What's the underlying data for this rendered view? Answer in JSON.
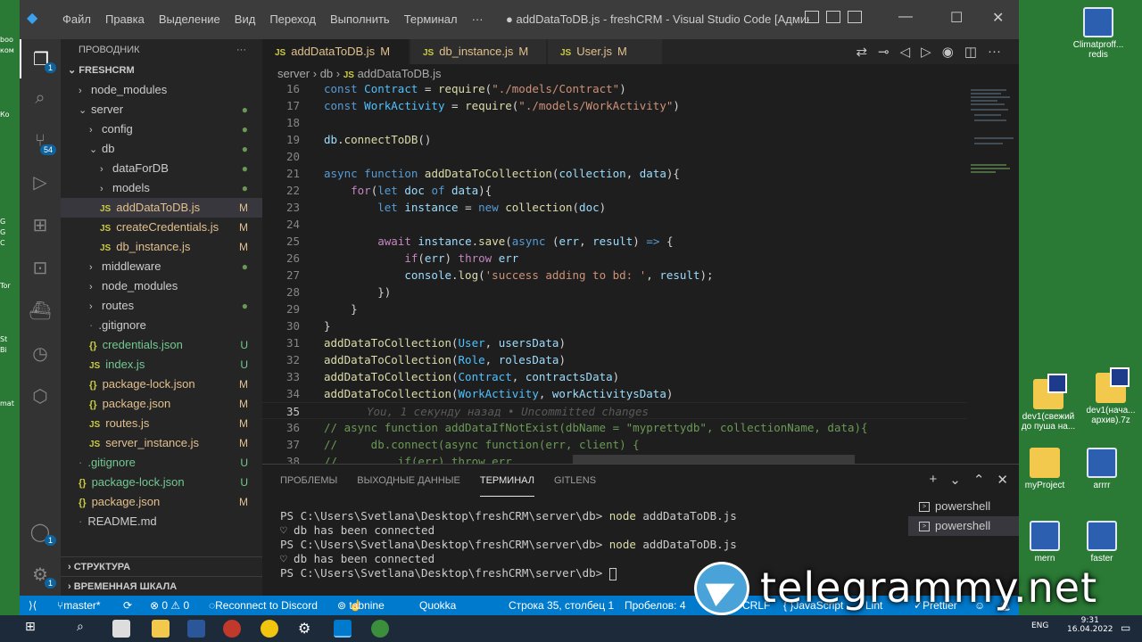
{
  "desktop": {
    "left_labels": [
      "boo",
      "ком",
      "",
      "",
      "",
      "",
      "",
      "Ко",
      "",
      "",
      "",
      "",
      "",
      "",
      "",
      "",
      "",
      "G",
      "G",
      "C",
      "",
      "",
      "",
      "Tor",
      "",
      "",
      "",
      "",
      "St",
      "Bi",
      "",
      "",
      "",
      "",
      "mat"
    ],
    "icons": [
      {
        "label": "Climatproff...",
        "sub": "redis"
      },
      {
        "label": "dev1(свежий до пуша на..."
      },
      {
        "label": "dev1(нача... архив).7z"
      },
      {
        "label": "myProject"
      },
      {
        "label": "arrrr"
      },
      {
        "label": "mern"
      },
      {
        "label": "faster"
      }
    ]
  },
  "titlebar": {
    "menu": [
      "Файл",
      "Правка",
      "Выделение",
      "Вид",
      "Переход",
      "Выполнить",
      "Терминал",
      "···"
    ],
    "title": "● addDataToDB.js - freshCRM - Visual Studio Code [Администр..."
  },
  "activity": {
    "explorer_badge": "1",
    "scm_badge": "54",
    "account_badge": "1",
    "settings_badge": "1"
  },
  "sidebar": {
    "header": "ПРОВОДНИК",
    "more": "···",
    "root": "FRESHCRM",
    "tree": [
      {
        "label": "node_modules",
        "depth": 1,
        "type": "folder",
        "chev": "›",
        "status": ""
      },
      {
        "label": "server",
        "depth": 1,
        "type": "folder",
        "chev": "⌄",
        "status": "●"
      },
      {
        "label": "config",
        "depth": 2,
        "type": "folder",
        "chev": "›",
        "status": "●"
      },
      {
        "label": "db",
        "depth": 2,
        "type": "folder",
        "chev": "⌄",
        "status": "●"
      },
      {
        "label": "dataForDB",
        "depth": 3,
        "type": "folder",
        "chev": "›",
        "status": "●"
      },
      {
        "label": "models",
        "depth": 3,
        "type": "folder",
        "chev": "›",
        "status": "●"
      },
      {
        "label": "addDataToDB.js",
        "depth": 3,
        "type": "js",
        "status": "M",
        "selected": true
      },
      {
        "label": "createCredentials.js",
        "depth": 3,
        "type": "js",
        "status": "M"
      },
      {
        "label": "db_instance.js",
        "depth": 3,
        "type": "js",
        "status": "M"
      },
      {
        "label": "middleware",
        "depth": 2,
        "type": "folder",
        "chev": "›",
        "status": "●"
      },
      {
        "label": "node_modules",
        "depth": 2,
        "type": "folder",
        "chev": "›",
        "status": ""
      },
      {
        "label": "routes",
        "depth": 2,
        "type": "folder",
        "chev": "›",
        "status": "●"
      },
      {
        "label": ".gitignore",
        "depth": 2,
        "type": "file",
        "status": ""
      },
      {
        "label": "credentials.json",
        "depth": 2,
        "type": "json",
        "status": "U"
      },
      {
        "label": "index.js",
        "depth": 2,
        "type": "js",
        "status": "U"
      },
      {
        "label": "package-lock.json",
        "depth": 2,
        "type": "json",
        "status": "M"
      },
      {
        "label": "package.json",
        "depth": 2,
        "type": "json",
        "status": "M"
      },
      {
        "label": "routes.js",
        "depth": 2,
        "type": "js",
        "status": "M"
      },
      {
        "label": "server_instance.js",
        "depth": 2,
        "type": "js",
        "status": "M"
      },
      {
        "label": ".gitignore",
        "depth": 1,
        "type": "file",
        "status": "U"
      },
      {
        "label": "package-lock.json",
        "depth": 1,
        "type": "json",
        "status": "U"
      },
      {
        "label": "package.json",
        "depth": 1,
        "type": "json",
        "status": "M"
      },
      {
        "label": "README.md",
        "depth": 1,
        "type": "file",
        "status": ""
      }
    ],
    "outline": "СТРУКТУРА",
    "timeline": "ВРЕМЕННАЯ ШКАЛА"
  },
  "tabs": [
    {
      "label": "addDataToDB.js",
      "mark": "M",
      "dirty": "●",
      "active": true
    },
    {
      "label": "db_instance.js",
      "mark": "M"
    },
    {
      "label": "User.js",
      "mark": "M"
    }
  ],
  "breadcrumb": [
    "server",
    "db",
    "addDataToDB.js"
  ],
  "code": [
    {
      "n": "17",
      "html": "<span class='kw'>const</span> <span class='cons'>WorkActivity</span> <span class='plain'>=</span> <span class='fn'>require</span><span class='plain'>(</span><span class='str'>\"./models/WorkActivity\"</span><span class='plain'>)</span>"
    },
    {
      "n": "18",
      "html": ""
    },
    {
      "n": "19",
      "html": "<span class='var'>db</span><span class='plain'>.</span><span class='fn'>connectToDB</span><span class='plain'>()</span>"
    },
    {
      "n": "20",
      "html": ""
    },
    {
      "n": "21",
      "html": "<span class='kw'>async</span> <span class='kw'>function</span> <span class='fn'>addDataToCollection</span><span class='plain'>(</span><span class='var'>collection</span><span class='plain'>, </span><span class='var'>data</span><span class='plain'>){</span>"
    },
    {
      "n": "22",
      "html": "    <span class='ctrl'>for</span><span class='plain'>(</span><span class='kw'>let</span> <span class='var'>doc</span> <span class='kw'>of</span> <span class='var'>data</span><span class='plain'>){</span>"
    },
    {
      "n": "23",
      "html": "        <span class='kw'>let</span> <span class='var'>instance</span> <span class='plain'>=</span> <span class='kw'>new</span> <span class='fn'>collection</span><span class='plain'>(</span><span class='var'>doc</span><span class='plain'>)</span>"
    },
    {
      "n": "24",
      "html": ""
    },
    {
      "n": "25",
      "html": "        <span class='ctrl'>await</span> <span class='var'>instance</span><span class='plain'>.</span><span class='fn'>save</span><span class='plain'>(</span><span class='kw'>async</span> <span class='plain'>(</span><span class='var'>err</span><span class='plain'>, </span><span class='var'>result</span><span class='plain'>) </span><span class='kw'>=&gt;</span> <span class='plain'>{</span>"
    },
    {
      "n": "26",
      "html": "            <span class='ctrl'>if</span><span class='plain'>(</span><span class='var'>err</span><span class='plain'>) </span><span class='ctrl'>throw</span> <span class='var'>err</span>"
    },
    {
      "n": "27",
      "html": "            <span class='var'>console</span><span class='plain'>.</span><span class='fn'>log</span><span class='plain'>(</span><span class='str'>'success adding to bd: '</span><span class='plain'>, </span><span class='var'>result</span><span class='plain'>);</span>"
    },
    {
      "n": "28",
      "html": "        <span class='plain'>})</span>"
    },
    {
      "n": "29",
      "html": "    <span class='plain'>}</span>"
    },
    {
      "n": "30",
      "html": "<span class='plain'>}</span>"
    },
    {
      "n": "31",
      "html": "<span class='fn'>addDataToCollection</span><span class='plain'>(</span><span class='cons'>User</span><span class='plain'>, </span><span class='var'>usersData</span><span class='plain'>)</span>"
    },
    {
      "n": "32",
      "html": "<span class='fn'>addDataToCollection</span><span class='plain'>(</span><span class='cons'>Role</span><span class='plain'>, </span><span class='var'>rolesData</span><span class='plain'>)</span>"
    },
    {
      "n": "33",
      "html": "<span class='fn'>addDataToCollection</span><span class='plain'>(</span><span class='cons'>Contract</span><span class='plain'>, </span><span class='var'>contractsData</span><span class='plain'>)</span>"
    },
    {
      "n": "34",
      "html": "<span class='fn'>addDataToCollection</span><span class='plain'>(</span><span class='cons'>WorkActivity</span><span class='plain'>, </span><span class='var'>workActivitysData</span><span class='plain'>)</span>"
    },
    {
      "n": "35",
      "html": "<span class='blame'>You, 1 секунду назад • Uncommitted changes</span>",
      "current": true
    },
    {
      "n": "36",
      "html": "<span class='cmt'>// async function addDataIfNotExist(dbName = \"myprettydb\", collectionName, data){</span>"
    },
    {
      "n": "37",
      "html": "<span class='cmt'>//     db.connect(async function(err, client) {</span>"
    },
    {
      "n": "38",
      "html": "<span class='cmt'>//         if(err) throw err</span>"
    }
  ],
  "panel": {
    "tabs": [
      "ПРОБЛЕМЫ",
      "ВЫХОДНЫЕ ДАННЫЕ",
      "ТЕРМИНАЛ",
      "GITLENS"
    ],
    "active_tab": 2,
    "terminal": [
      {
        "prompt": "PS C:\\Users\\Svetlana\\Desktop\\freshCRM\\server\\db> ",
        "cmd": "node",
        "arg": " addDataToDB.js"
      },
      {
        "prompt": "♡ db has been connected",
        "cmd": "",
        "arg": ""
      },
      {
        "prompt": "PS C:\\Users\\Svetlana\\Desktop\\freshCRM\\server\\db> ",
        "cmd": "node",
        "arg": " addDataToDB.js"
      },
      {
        "prompt": "♡ db has been connected",
        "cmd": "",
        "arg": ""
      },
      {
        "prompt": "PS C:\\Users\\Svetlana\\Desktop\\freshCRM\\server\\db> ",
        "cmd": "",
        "arg": "",
        "cursor": true
      }
    ],
    "shells": [
      "powershell",
      "powershell"
    ]
  },
  "status": {
    "branch": "master*",
    "errors": "⊗ 0 ⚠ 0",
    "discord": "Reconnect to Discord",
    "tabnine": "tabnine",
    "quokka": "Quokka",
    "position": "Строка 35, столбец 1",
    "spaces": "Пробелов: 4",
    "eol": "CRLF",
    "lang": "JavaScript",
    "lint": "Lint",
    "prettier": "Prettier"
  },
  "taskbar": {
    "lang": "ENG",
    "time": "9:31",
    "date": "16.04.2022"
  },
  "watermark": "telegrammy.net"
}
